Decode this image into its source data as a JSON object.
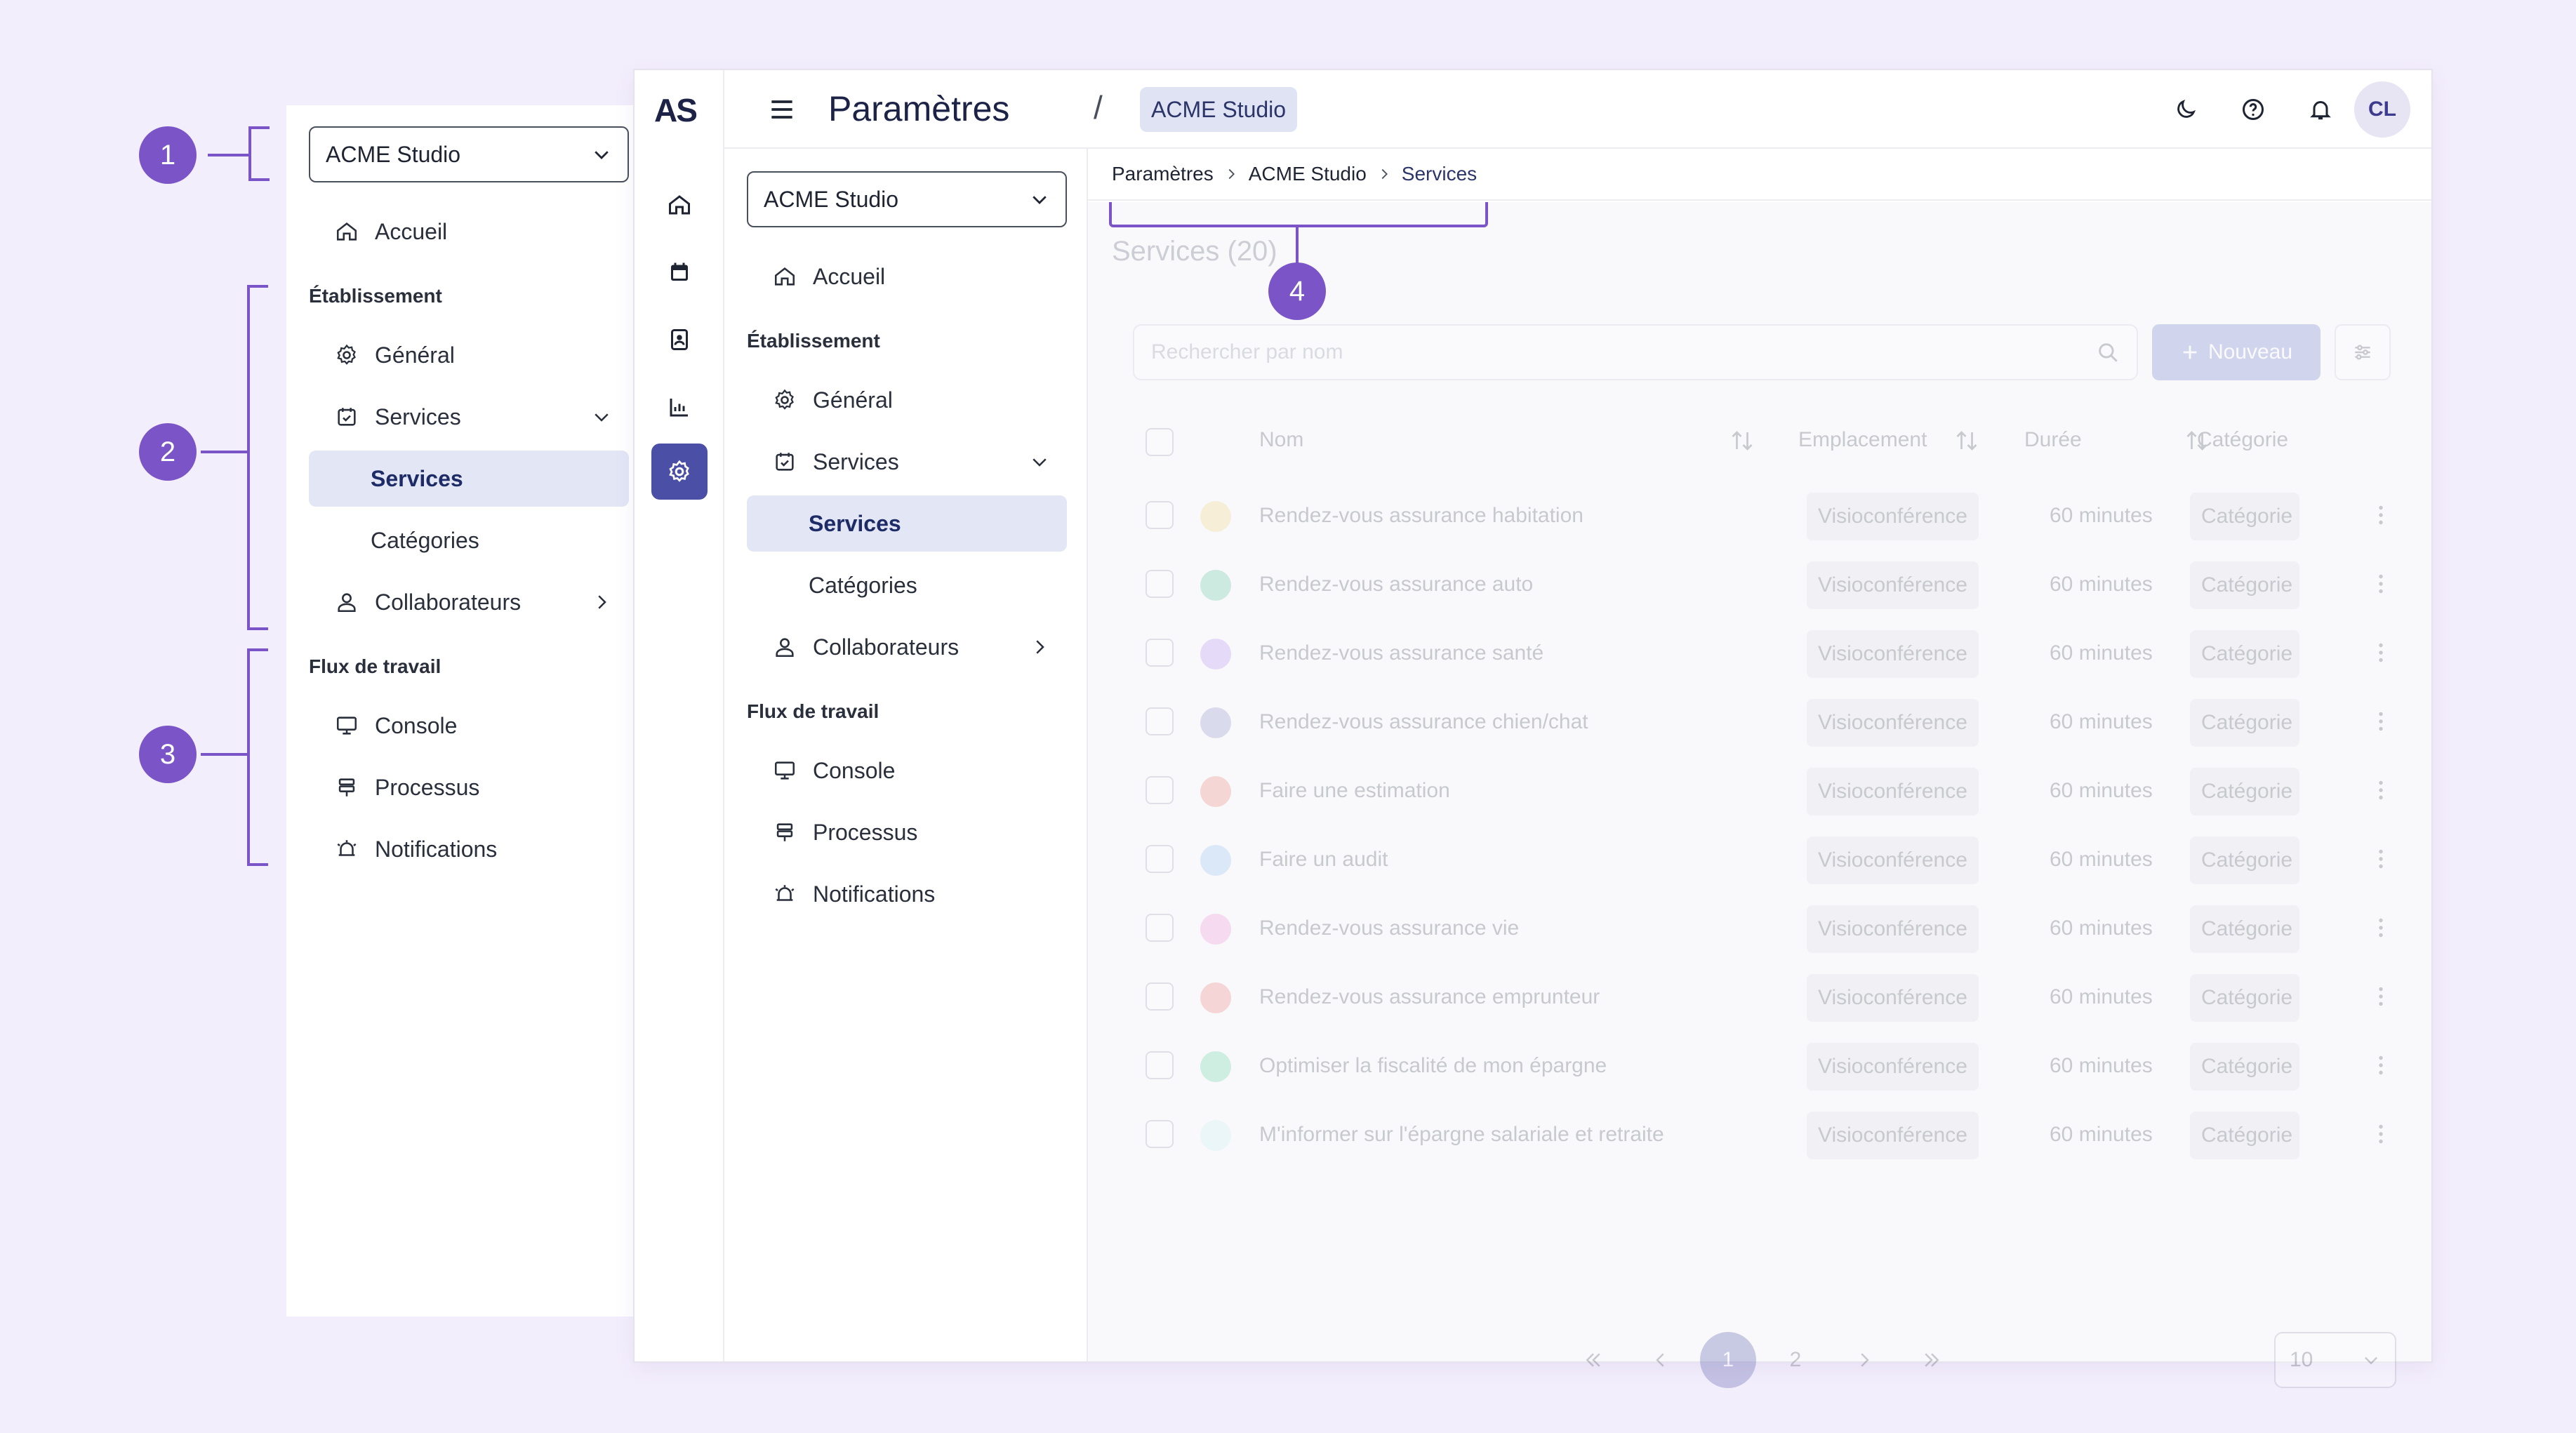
{
  "annotations": [
    "1",
    "2",
    "3",
    "4"
  ],
  "colors": {
    "accent": "#7b55c7",
    "brand": "#4b4fa6",
    "background": "#f3eefc"
  },
  "app": {
    "logo": "AS",
    "title": "Paramètres",
    "separator": "/",
    "workspace_chip": "ACME Studio",
    "user_initials": "CL",
    "rail_icons": [
      "home-icon",
      "calendar-icon",
      "contacts-icon",
      "chart-icon",
      "settings-icon"
    ],
    "top_icons": [
      "moon-icon",
      "help-icon",
      "bell-icon"
    ]
  },
  "sidebar": {
    "workspace": "ACME Studio",
    "home": "Accueil",
    "section_establishment": "Établissement",
    "general": "Général",
    "services": "Services",
    "services_sub": "Services",
    "categories": "Catégories",
    "collaborators": "Collaborateurs",
    "section_workflow": "Flux de travail",
    "console": "Console",
    "processes": "Processus",
    "notifications": "Notifications"
  },
  "breadcrumb": [
    "Paramètres",
    "ACME Studio",
    "Services"
  ],
  "services_page": {
    "title": "Services (20)",
    "search_placeholder": "Rechercher par nom",
    "new_button": "Nouveau",
    "columns": {
      "name": "Nom",
      "location": "Emplacement",
      "duration": "Durée",
      "category": "Catégorie"
    },
    "rows": [
      {
        "name": "Rendez-vous assurance habitation",
        "location": "Visioconférence",
        "duration": "60 minutes",
        "category": "Catégorie",
        "color": "#f2d27a"
      },
      {
        "name": "Rendez-vous assurance auto",
        "location": "Visioconférence",
        "duration": "60 minutes",
        "category": "Catégorie",
        "color": "#5ec79a"
      },
      {
        "name": "Rendez-vous assurance santé",
        "location": "Visioconférence",
        "duration": "60 minutes",
        "category": "Catégorie",
        "color": "#b48df0"
      },
      {
        "name": "Rendez-vous assurance chien/chat",
        "location": "Visioconférence",
        "duration": "60 minutes",
        "category": "Catégorie",
        "color": "#8a8fc4"
      },
      {
        "name": "Faire une estimation",
        "location": "Visioconférence",
        "duration": "60 minutes",
        "category": "Catégorie",
        "color": "#e8806f"
      },
      {
        "name": "Faire un audit",
        "location": "Visioconférence",
        "duration": "60 minutes",
        "category": "Catégorie",
        "color": "#8fbff0"
      },
      {
        "name": "Rendez-vous assurance vie",
        "location": "Visioconférence",
        "duration": "60 minutes",
        "category": "Catégorie",
        "color": "#f08fd2"
      },
      {
        "name": "Rendez-vous assurance emprunteur",
        "location": "Visioconférence",
        "duration": "60 minutes",
        "category": "Catégorie",
        "color": "#ef7a7a"
      },
      {
        "name": "Optimiser la fiscalité de mon épargne",
        "location": "Visioconférence",
        "duration": "60 minutes",
        "category": "Catégorie",
        "color": "#5ed39a"
      },
      {
        "name": "M'informer sur l'épargne salariale et retraite",
        "location": "Visioconférence",
        "duration": "60 minutes",
        "category": "Catégorie",
        "color": "#c9f1f0"
      }
    ],
    "pagination": {
      "pages": [
        "1",
        "2"
      ],
      "current": "1",
      "per_page": "10"
    }
  }
}
